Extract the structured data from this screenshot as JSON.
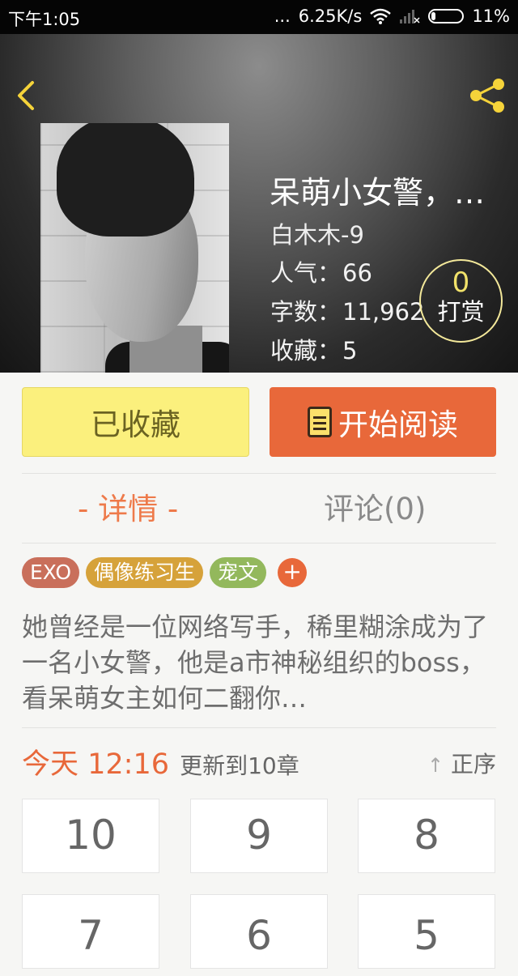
{
  "status": {
    "time": "下午1:05",
    "net_speed": "6.25K/s",
    "battery": "11%",
    "dots": "..."
  },
  "book": {
    "title": "呆萌小女警，…",
    "author": "白木木-9",
    "popularity_label": "人气：",
    "popularity": "66",
    "words_label": "字数：",
    "words": "11,962",
    "favorites_label": "收藏：",
    "favorites": "5",
    "reward_count": "0",
    "reward_label": "打赏"
  },
  "actions": {
    "favorited_label": "已收藏",
    "read_label": "开始阅读"
  },
  "tabs": [
    {
      "label": "- 详情 -"
    },
    {
      "label": "评论(0)"
    }
  ],
  "tags": [
    "EXO",
    "偶像练习生",
    "宠文"
  ],
  "add_tag": "+",
  "description": "她曾经是一位网络写手，稀里糊涂成为了一名小女警，他是a市神秘组织的boss，看呆萌女主如何二翻你…",
  "update": {
    "time": "今天 12:16",
    "text": "更新到10章",
    "sort_label": "正序",
    "sort_arrow": "↑"
  },
  "chapters": [
    "10",
    "9",
    "8",
    "7",
    "6",
    "5"
  ],
  "colors": {
    "accent": "#e8683a",
    "favorite_bg": "#fbf07d",
    "icon_yellow": "#f5d33a"
  }
}
